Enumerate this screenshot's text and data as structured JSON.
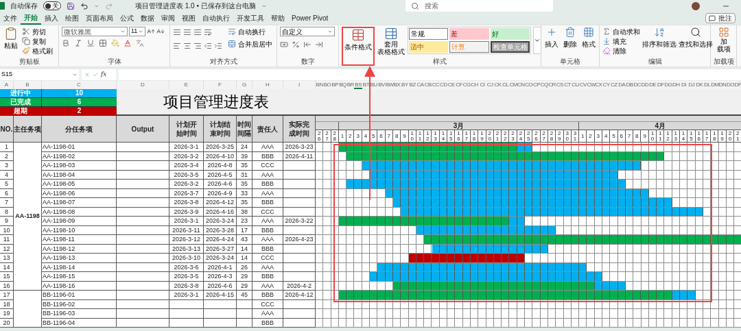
{
  "title_bar": {
    "autosave_label": "自动保存",
    "autosave_on": false,
    "autosave_state": "关",
    "document_title": "项目管理进度表 1.0 • 已保存到这台电脑",
    "search_placeholder": "搜索"
  },
  "tabs": [
    {
      "label": "文件",
      "selected": false
    },
    {
      "label": "开始",
      "selected": true
    },
    {
      "label": "插入",
      "selected": false
    },
    {
      "label": "绘图",
      "selected": false
    },
    {
      "label": "页面布局",
      "selected": false
    },
    {
      "label": "公式",
      "selected": false
    },
    {
      "label": "数据",
      "selected": false
    },
    {
      "label": "审阅",
      "selected": false
    },
    {
      "label": "视图",
      "selected": false
    },
    {
      "label": "自动执行",
      "selected": false
    },
    {
      "label": "开发工具",
      "selected": false
    },
    {
      "label": "帮助",
      "selected": false
    },
    {
      "label": "Power Pivot",
      "selected": false
    }
  ],
  "comment_button": "批注",
  "ribbon": {
    "clipboard": {
      "title": "剪贴板",
      "paste": "粘贴",
      "cut": "剪切",
      "copy": "复制",
      "format_painter": "格式刷"
    },
    "font": {
      "title": "字体",
      "font_name": "微软雅黑",
      "font_size": "11"
    },
    "alignment": {
      "title": "对齐方式",
      "wrap_text": "自动换行",
      "merge_center": "合并后居中"
    },
    "number": {
      "title": "数字",
      "format": "自定义"
    },
    "styles": {
      "title": "样式",
      "conditional_format": "条件格式",
      "table_format": [
        "套用",
        "表格格式"
      ],
      "cell_styles": [
        {
          "label": "常规",
          "kind": "normal"
        },
        {
          "label": "差",
          "kind": "bad"
        },
        {
          "label": "好",
          "kind": "good"
        },
        {
          "label": "适中",
          "kind": "neutral"
        },
        {
          "label": "计算",
          "kind": "calculation"
        },
        {
          "label": "检查单元格",
          "kind": "check"
        }
      ]
    },
    "cells": {
      "title": "单元格",
      "insert": "插入",
      "delete": "删除",
      "format": "格式"
    },
    "editing": {
      "title": "编辑",
      "autosum": "自动求和",
      "fill": "填充",
      "clear": "清除",
      "sort_filter": "排序和筛选",
      "find_select": "查找和选择"
    },
    "addins": {
      "title": "加载项",
      "button": [
        "加",
        "载项"
      ]
    }
  },
  "formula_bar": {
    "name_box": "S15",
    "fx": "fx"
  },
  "sheet": {
    "column_letters": [
      "A",
      "B",
      "C",
      "D",
      "E",
      "F",
      "G",
      "H",
      "I"
    ],
    "gantt_column_letters": [
      "BN",
      "BO",
      "BP",
      "BQ",
      "BR",
      "BS",
      "BT",
      "BU",
      "BV",
      "BW",
      "BX",
      "BY",
      "BZ",
      "CA",
      "CB",
      "CC",
      "CD",
      "CE",
      "CF",
      "CG",
      "CH",
      "CI",
      "CJ",
      "CK",
      "CL",
      "CM",
      "CN",
      "CO",
      "CP",
      "CQ",
      "CR",
      "CS",
      "CT",
      "CU",
      "CV",
      "CW",
      "CX",
      "CY",
      "CZ",
      "DA",
      "DB",
      "DC",
      "DD",
      "DE",
      "DF",
      "DG",
      "DH",
      "DI",
      "DJ",
      "DK",
      "DL",
      "DM",
      "DN",
      "DO",
      "DP"
    ],
    "summary": [
      {
        "label": "进行中",
        "value": "10",
        "kind": "in_progress"
      },
      {
        "label": "已完成",
        "value": "6",
        "kind": "done"
      },
      {
        "label": "超期",
        "value": "2",
        "kind": "overdue"
      }
    ],
    "title": "项目管理进度表",
    "headers": [
      "NO.",
      "主任务项",
      "分任务项",
      "Output",
      "计划开始时间",
      "计划结束时间",
      "时间间隔",
      "责任人",
      "实际完成时间"
    ],
    "months": [
      {
        "days": [
          "26",
          "27",
          "28"
        ]
      },
      {
        "label": "3月",
        "days": [
          "1",
          "2",
          "3",
          "4",
          "5",
          "6",
          "7",
          "8",
          "9",
          "10",
          "11",
          "12",
          "13",
          "14",
          "15",
          "16",
          "17",
          "18",
          "19",
          "20",
          "21",
          "22",
          "23",
          "24",
          "25",
          "26",
          "27",
          "28",
          "29",
          "30",
          "31"
        ]
      },
      {
        "label": "4月",
        "days": [
          "1",
          "2",
          "3",
          "4",
          "5",
          "6",
          "7",
          "8",
          "9",
          "10",
          "11",
          "12",
          "13",
          "14",
          "15",
          "16",
          "17",
          "18",
          "19",
          "20",
          "21"
        ]
      }
    ],
    "groups": [
      {
        "name": "AA-1198",
        "rows": [
          {
            "no": "1",
            "task": "AA-1198-01",
            "start": "2026-3-1",
            "end": "2026-3-25",
            "days": "24",
            "owner": "AAA",
            "actual": "2026-3-23",
            "kind": "done"
          },
          {
            "no": "2",
            "task": "AA-1198-02",
            "start": "2026-3-2",
            "end": "2026-4-10",
            "days": "39",
            "owner": "BBB",
            "actual": "2026-4-11",
            "kind": "done"
          },
          {
            "no": "3",
            "task": "AA-1198-03",
            "start": "2026-3-4",
            "end": "2026-4-8",
            "days": "35",
            "owner": "CCC",
            "kind": "in_progress"
          },
          {
            "no": "4",
            "task": "AA-1198-04",
            "start": "2026-3-5",
            "end": "2026-4-5",
            "days": "31",
            "owner": "AAA",
            "kind": "in_progress"
          },
          {
            "no": "5",
            "task": "AA-1198-05",
            "start": "2026-3-2",
            "end": "2026-4-6",
            "days": "35",
            "owner": "BBB",
            "kind": "in_progress"
          },
          {
            "no": "6",
            "task": "AA-1198-06",
            "start": "2026-3-7",
            "end": "2026-4-9",
            "days": "33",
            "owner": "AAA",
            "kind": "in_progress"
          },
          {
            "no": "7",
            "task": "AA-1198-07",
            "start": "2026-3-8",
            "end": "2026-4-12",
            "days": "35",
            "owner": "BBB",
            "kind": "in_progress"
          },
          {
            "no": "8",
            "task": "AA-1198-08",
            "start": "2026-3-9",
            "end": "2026-4-16",
            "days": "38",
            "owner": "CCC",
            "kind": "in_progress"
          },
          {
            "no": "9",
            "task": "AA-1198-09",
            "start": "2026-3-1",
            "end": "2026-3-24",
            "days": "23",
            "owner": "AAA",
            "actual": "2026-3-22",
            "kind": "done"
          },
          {
            "no": "10",
            "task": "AA-1198-10",
            "start": "2026-3-11",
            "end": "2026-3-28",
            "days": "17",
            "owner": "BBB",
            "kind": "in_progress"
          },
          {
            "no": "11",
            "task": "AA-1198-11",
            "start": "2026-3-12",
            "end": "2026-4-24",
            "days": "43",
            "owner": "AAA",
            "actual": "2026-4-23",
            "kind": "done"
          },
          {
            "no": "12",
            "task": "AA-1198-12",
            "start": "2026-3-13",
            "end": "2026-3-27",
            "days": "14",
            "owner": "BBB",
            "kind": "in_progress"
          },
          {
            "no": "13",
            "task": "AA-1198-13",
            "start": "2026-3-10",
            "end": "2026-3-24",
            "days": "14",
            "owner": "CCC",
            "kind": "overdue"
          },
          {
            "no": "14",
            "task": "AA-1198-14",
            "start": "2026-3-6",
            "end": "2026-4-1",
            "days": "26",
            "owner": "AAA",
            "kind": "in_progress"
          },
          {
            "no": "15",
            "task": "AA-1198-15",
            "start": "2026-3-5",
            "end": "2026-4-3",
            "days": "29",
            "owner": "BBB",
            "kind": "in_progress"
          },
          {
            "no": "16",
            "task": "AA-1198-16",
            "start": "2026-3-8",
            "end": "2026-4-6",
            "days": "29",
            "owner": "AAA",
            "actual": "2026-4-2",
            "kind": "done"
          }
        ]
      },
      {
        "rows": [
          {
            "no": "17",
            "task": "BB-1196-01",
            "start": "2026-3-1",
            "end": "2026-4-15",
            "days": "45",
            "owner": "BBB",
            "actual": "2026-4-12",
            "kind": "done"
          },
          {
            "no": "18",
            "task": "BB-1196-02",
            "owner": "CCC"
          },
          {
            "no": "19",
            "task": "BB-1196-03",
            "owner": "AAA"
          },
          {
            "no": "20",
            "task": "BB-1196-04",
            "owner": "BBB"
          }
        ]
      }
    ]
  }
}
